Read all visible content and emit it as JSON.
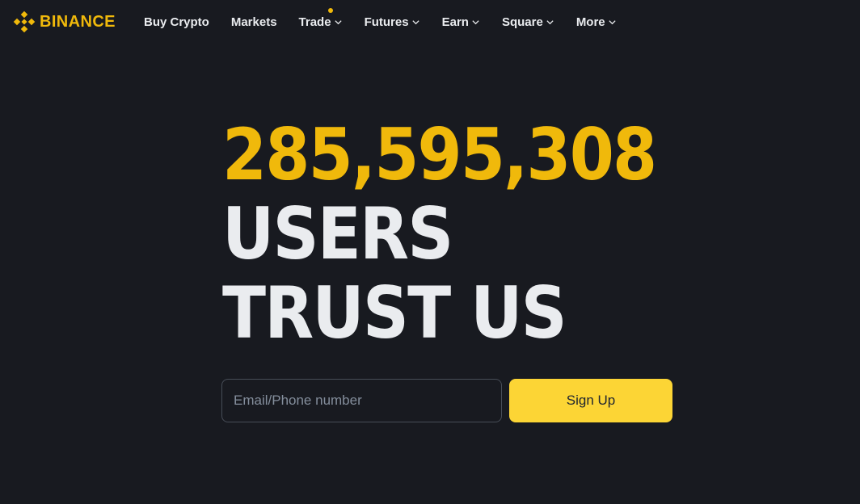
{
  "brand": {
    "name": "BINANCE",
    "color": "#f0b90b",
    "icon": "binance-diamond-logo-icon"
  },
  "nav": {
    "items": [
      {
        "label": "Buy Crypto",
        "has_dropdown": false
      },
      {
        "label": "Markets",
        "has_dropdown": false
      },
      {
        "label": "Trade",
        "has_dropdown": true,
        "has_indicator": true
      },
      {
        "label": "Futures",
        "has_dropdown": true
      },
      {
        "label": "Earn",
        "has_dropdown": true
      },
      {
        "label": "Square",
        "has_dropdown": true
      },
      {
        "label": "More",
        "has_dropdown": true
      }
    ],
    "dropdown_icon": "chevron-down-icon"
  },
  "hero": {
    "count": "285,595,308",
    "line2": "USERS",
    "line3": "TRUST US"
  },
  "signup": {
    "placeholder": "Email/Phone number",
    "button_label": "Sign Up"
  },
  "colors": {
    "background": "#181a20",
    "accent": "#f0b90b",
    "button": "#fcd535",
    "text": "#eaecef",
    "muted": "#848e9c"
  }
}
